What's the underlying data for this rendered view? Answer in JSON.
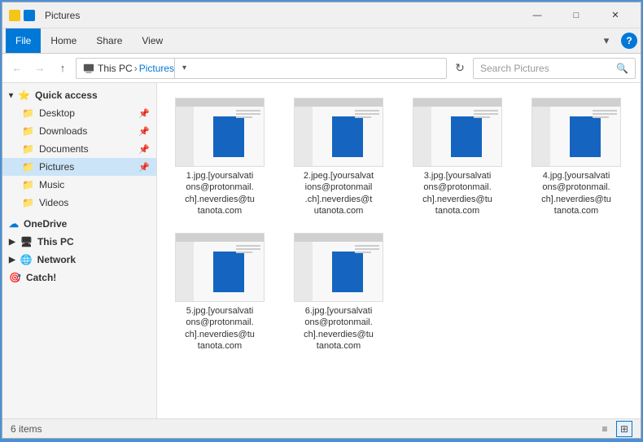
{
  "window": {
    "title": "Pictures",
    "title_icon_label": "folder-icon"
  },
  "ribbon": {
    "tabs": [
      "File",
      "Home",
      "Share",
      "View"
    ],
    "active_tab": "File",
    "chevron_label": "▾",
    "help_label": "?"
  },
  "address_bar": {
    "back_label": "←",
    "forward_label": "→",
    "up_label": "↑",
    "path_pc": "This PC",
    "path_separator": "›",
    "path_folder": "Pictures",
    "dropdown_label": "▾",
    "refresh_label": "↻",
    "search_placeholder": "Search Pictures",
    "search_icon": "🔍"
  },
  "title_controls": {
    "minimize": "—",
    "maximize": "□",
    "close": "✕"
  },
  "sidebar": {
    "quick_access_label": "Quick access",
    "items": [
      {
        "label": "Desktop",
        "icon": "📁",
        "pinned": true
      },
      {
        "label": "Downloads",
        "icon": "📁",
        "pinned": true
      },
      {
        "label": "Documents",
        "icon": "📁",
        "pinned": true
      },
      {
        "label": "Pictures",
        "icon": "📁",
        "pinned": true,
        "active": true
      },
      {
        "label": "Music",
        "icon": "📁",
        "pinned": false
      },
      {
        "label": "Videos",
        "icon": "📁",
        "pinned": false
      }
    ],
    "onedrive_label": "OneDrive",
    "thispc_label": "This PC",
    "network_label": "Network",
    "catch_label": "Catch!"
  },
  "files": [
    {
      "name": "1.jpg.[yoursalvati\nons@protonmail.\nch].neverdies@tu\ntanota.com"
    },
    {
      "name": "2.jpeg.[yoursalvat\nions@protonmail\n.ch].neverdies@t\nutanota.com"
    },
    {
      "name": "3.jpg.[yoursalvati\nons@protonmail.\nch].neverdies@tu\ntanota.com"
    },
    {
      "name": "4.jpg.[yoursalvati\nons@protonmail.\nch].neverdies@tu\ntanota.com"
    },
    {
      "name": "5.jpg.[yoursalvati\nons@protonmail.\nch].neverdies@tu\ntanota.com"
    },
    {
      "name": "6.jpg.[yoursalvati\nons@protonmail.\nch].neverdies@tu\ntanota.com"
    }
  ],
  "status_bar": {
    "item_count": "6 items",
    "view_list_label": "≡",
    "view_grid_label": "⊞"
  }
}
